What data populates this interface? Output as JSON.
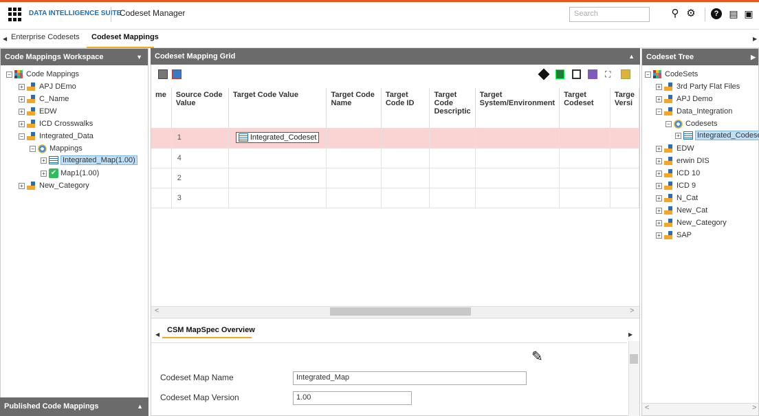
{
  "header": {
    "suite": "DATA INTELLIGENCE SUITE",
    "app": "Codeset Manager",
    "search_placeholder": "Search",
    "accent": "#e8581c"
  },
  "tabs": [
    {
      "label": "Enterprise Codesets"
    },
    {
      "label": "Codeset Mappings",
      "selected": true
    }
  ],
  "left": {
    "title": "Code Mappings Workspace",
    "tree": [
      {
        "label": "Code Mappings"
      },
      {
        "label": "APJ DEmo"
      },
      {
        "label": "C_Name"
      },
      {
        "label": "EDW"
      },
      {
        "label": "ICD Crosswalks"
      },
      {
        "label": "Integrated_Data"
      },
      {
        "label": "Mappings"
      },
      {
        "label": "Integrated_Map(1.00)"
      },
      {
        "label": "Map1(1.00)"
      },
      {
        "label": "New_Category"
      }
    ],
    "footer": "Published Code Mappings"
  },
  "grid": {
    "title": "Codeset Mapping Grid",
    "columns": [
      "me",
      "Source Code Value",
      "Target Code Value",
      "Target Code Name",
      "Target Code ID",
      "Target Code Descriptic",
      "Target System/Environment",
      "Target Codeset",
      "Targe Versi"
    ],
    "rows": [
      {
        "source": "1",
        "target": "Integrated_Codeset",
        "highlighted": true
      },
      {
        "source": "4",
        "target": ""
      },
      {
        "source": "2",
        "target": ""
      },
      {
        "source": "3",
        "target": ""
      }
    ]
  },
  "overview": {
    "tab": "CSM MapSpec Overview",
    "fields": [
      {
        "label": "Codeset Map Name",
        "value": "Integrated_Map"
      },
      {
        "label": "Codeset Map Version",
        "value": "1.00"
      }
    ]
  },
  "right": {
    "title": "Codeset Tree",
    "tree": [
      {
        "label": "CodeSets"
      },
      {
        "label": "3rd Party Flat Files"
      },
      {
        "label": "APJ Demo"
      },
      {
        "label": "Data_Integration"
      },
      {
        "label": "Codesets"
      },
      {
        "label": "Integrated_Codese"
      },
      {
        "label": "EDW"
      },
      {
        "label": "erwin DIS"
      },
      {
        "label": "ICD 10"
      },
      {
        "label": "ICD 9"
      },
      {
        "label": "N_Cat"
      },
      {
        "label": "New_Cat"
      },
      {
        "label": "New_Category"
      },
      {
        "label": "SAP"
      }
    ]
  }
}
